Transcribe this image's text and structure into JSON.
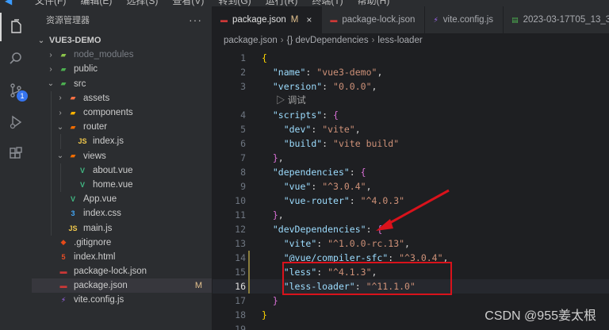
{
  "menubar": {
    "logo": "◀",
    "items": [
      "文件(F)",
      "编辑(E)",
      "选择(S)",
      "查看(V)",
      "转到(G)",
      "运行(R)",
      "终端(T)",
      "帮助(H)"
    ]
  },
  "activity": {
    "items": [
      {
        "name": "explorer-icon"
      },
      {
        "name": "search-icon"
      },
      {
        "name": "source-control-icon",
        "badge": "1"
      },
      {
        "name": "run-debug-icon"
      },
      {
        "name": "extensions-icon"
      }
    ]
  },
  "explorer": {
    "title": "资源管理器",
    "more": "···",
    "rows": [
      {
        "label": "VUE3-DEMO",
        "depth": 0,
        "chev": "⌄",
        "root": true
      },
      {
        "label": "node_modules",
        "depth": 1,
        "chev": "›",
        "icon": "folder-node",
        "dim": true
      },
      {
        "label": "public",
        "depth": 1,
        "chev": "›",
        "icon": "folder-public"
      },
      {
        "label": "src",
        "depth": 1,
        "chev": "⌄",
        "icon": "folder-src"
      },
      {
        "label": "assets",
        "depth": 2,
        "chev": "›",
        "icon": "folder-assets"
      },
      {
        "label": "components",
        "depth": 2,
        "chev": "›",
        "icon": "folder-components"
      },
      {
        "label": "router",
        "depth": 2,
        "chev": "⌄",
        "icon": "folder-router"
      },
      {
        "label": "index.js",
        "depth": 3,
        "icon": "js"
      },
      {
        "label": "views",
        "depth": 2,
        "chev": "⌄",
        "icon": "folder-views"
      },
      {
        "label": "about.vue",
        "depth": 3,
        "icon": "vue"
      },
      {
        "label": "home.vue",
        "depth": 3,
        "icon": "vue"
      },
      {
        "label": "App.vue",
        "depth": 2,
        "icon": "vue"
      },
      {
        "label": "index.css",
        "depth": 2,
        "icon": "css"
      },
      {
        "label": "main.js",
        "depth": 2,
        "icon": "js"
      },
      {
        "label": ".gitignore",
        "depth": 1,
        "icon": "git"
      },
      {
        "label": "index.html",
        "depth": 1,
        "icon": "html"
      },
      {
        "label": "package-lock.json",
        "depth": 1,
        "icon": "npm"
      },
      {
        "label": "package.json",
        "depth": 1,
        "icon": "npm",
        "selected": true,
        "mod": "M"
      },
      {
        "label": "vite.config.js",
        "depth": 1,
        "icon": "vite"
      }
    ]
  },
  "tabs": [
    {
      "label": "package.json",
      "icon": "npm",
      "active": true,
      "mod": "M",
      "close": "×"
    },
    {
      "label": "package-lock.json",
      "icon": "npm"
    },
    {
      "label": "vite.config.js",
      "icon": "vite"
    },
    {
      "label": "2023-03-17T05_13_3",
      "icon": "file"
    }
  ],
  "breadcrumb": {
    "file": "package.json",
    "sep": "›",
    "object": "{} devDependencies",
    "key": "less-loader"
  },
  "codelens": "▷ 调试",
  "code": [
    {
      "n": "1",
      "t": [
        [
          "b1",
          "{"
        ]
      ]
    },
    {
      "n": "2",
      "t": [
        [
          "p",
          "  "
        ],
        [
          "k",
          "\"name\""
        ],
        [
          "p",
          ": "
        ],
        [
          "s",
          "\"vue3-demo\""
        ],
        [
          "p",
          ","
        ]
      ]
    },
    {
      "n": "3",
      "t": [
        [
          "p",
          "  "
        ],
        [
          "k",
          "\"version\""
        ],
        [
          "p",
          ": "
        ],
        [
          "s",
          "\"0.0.0\""
        ],
        [
          "p",
          ","
        ]
      ]
    },
    {
      "n": "4",
      "t": [
        [
          "p",
          "  "
        ],
        [
          "k",
          "\"scripts\""
        ],
        [
          "p",
          ": "
        ],
        [
          "b2",
          "{"
        ]
      ]
    },
    {
      "n": "5",
      "t": [
        [
          "p",
          "    "
        ],
        [
          "k",
          "\"dev\""
        ],
        [
          "p",
          ": "
        ],
        [
          "s",
          "\"vite\""
        ],
        [
          "p",
          ","
        ]
      ]
    },
    {
      "n": "6",
      "t": [
        [
          "p",
          "    "
        ],
        [
          "k",
          "\"build\""
        ],
        [
          "p",
          ": "
        ],
        [
          "s",
          "\"vite build\""
        ]
      ]
    },
    {
      "n": "7",
      "t": [
        [
          "p",
          "  "
        ],
        [
          "b2",
          "}"
        ],
        [
          "p",
          ","
        ]
      ]
    },
    {
      "n": "8",
      "t": [
        [
          "p",
          "  "
        ],
        [
          "k",
          "\"dependencies\""
        ],
        [
          "p",
          ": "
        ],
        [
          "b2",
          "{"
        ]
      ]
    },
    {
      "n": "9",
      "t": [
        [
          "p",
          "    "
        ],
        [
          "k",
          "\"vue\""
        ],
        [
          "p",
          ": "
        ],
        [
          "s",
          "\"^3.0.4\""
        ],
        [
          "p",
          ","
        ]
      ]
    },
    {
      "n": "10",
      "t": [
        [
          "p",
          "    "
        ],
        [
          "k",
          "\"vue-router\""
        ],
        [
          "p",
          ": "
        ],
        [
          "s",
          "\"^4.0.3\""
        ]
      ]
    },
    {
      "n": "11",
      "t": [
        [
          "p",
          "  "
        ],
        [
          "b2",
          "}"
        ],
        [
          "p",
          ","
        ]
      ]
    },
    {
      "n": "12",
      "t": [
        [
          "p",
          "  "
        ],
        [
          "k",
          "\"devDependencies\""
        ],
        [
          "p",
          ": "
        ],
        [
          "b2",
          "{"
        ]
      ]
    },
    {
      "n": "13",
      "t": [
        [
          "p",
          "    "
        ],
        [
          "k",
          "\"vite\""
        ],
        [
          "p",
          ": "
        ],
        [
          "s",
          "\"^1.0.0-rc.13\""
        ],
        [
          "p",
          ","
        ]
      ]
    },
    {
      "n": "14",
      "t": [
        [
          "p",
          "    "
        ],
        [
          "k",
          "\"@vue/compiler-sfc\""
        ],
        [
          "p",
          ": "
        ],
        [
          "s",
          "\"^3.0.4\""
        ],
        [
          "p",
          ","
        ]
      ]
    },
    {
      "n": "15",
      "t": [
        [
          "p",
          "    "
        ],
        [
          "k",
          "\"less\""
        ],
        [
          "p",
          ": "
        ],
        [
          "s",
          "\"^4.1.3\""
        ],
        [
          "p",
          ","
        ]
      ]
    },
    {
      "n": "16",
      "t": [
        [
          "p",
          "    "
        ],
        [
          "k",
          "\"less-loader\""
        ],
        [
          "p",
          ": "
        ],
        [
          "s",
          "\"^11.1.0\""
        ]
      ],
      "current": true
    },
    {
      "n": "17",
      "t": [
        [
          "p",
          "  "
        ],
        [
          "b2",
          "}"
        ]
      ]
    },
    {
      "n": "18",
      "t": [
        [
          "b1",
          "}"
        ]
      ]
    },
    {
      "n": "19",
      "t": []
    }
  ],
  "watermark": "CSDN @955姜太根",
  "colors": {
    "accent": "#3574f0",
    "modified": "#e2c08d",
    "highlight_box": "#d9121b",
    "json_key": "#9cdcfe",
    "json_string": "#ce9178"
  }
}
